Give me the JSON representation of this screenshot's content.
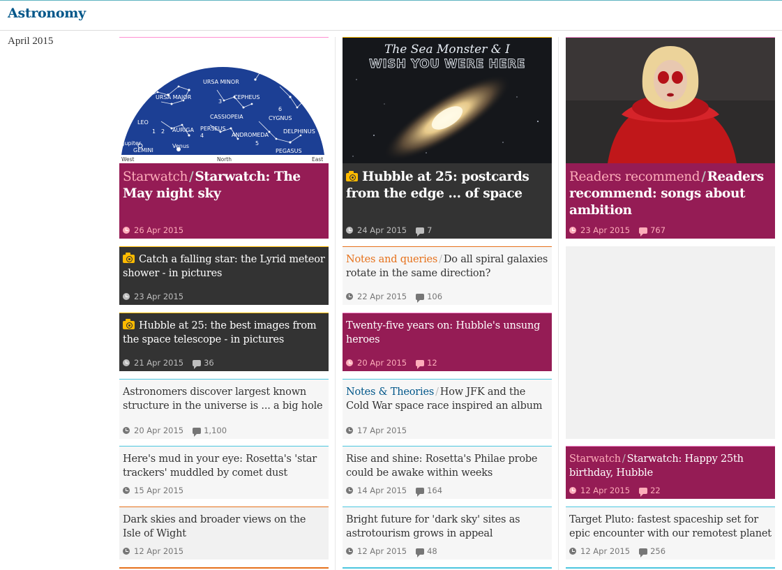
{
  "page": {
    "title": "Astronomy",
    "month": "April 2015"
  },
  "cards": {
    "c1": {
      "kicker": "Starwatch",
      "headline": "Starwatch: The May night sky",
      "date": "26 Apr 2015",
      "comments": ""
    },
    "c2": {
      "kicker": "",
      "headline": "Hubble at 25: postcards from the edge ... of space",
      "date": "24 Apr 2015",
      "comments": "7"
    },
    "c3": {
      "kicker": "Readers recommend",
      "headline": "Readers recommend: songs about ambition",
      "date": "23 Apr 2015",
      "comments": "767"
    },
    "c4": {
      "kicker": "",
      "headline": "Catch a falling star: the Lyrid meteor shower - in pictures",
      "date": "23 Apr 2015",
      "comments": ""
    },
    "c5": {
      "kicker": "Notes and queries",
      "headline": "Do all spiral galaxies rotate in the same direction?",
      "date": "22 Apr 2015",
      "comments": "106"
    },
    "c6": {
      "kicker": "",
      "headline": "Hubble at 25: the best images from the space telescope - in pictures",
      "date": "21 Apr 2015",
      "comments": "36"
    },
    "c7": {
      "kicker": "",
      "headline": "Twenty-five years on: Hubble's unsung heroes",
      "date": "20 Apr 2015",
      "comments": "12"
    },
    "c8": {
      "kicker": "",
      "headline": "Astronomers discover largest known structure in the universe is ... a big hole",
      "date": "20 Apr 2015",
      "comments": "1,100"
    },
    "c9": {
      "kicker": "Notes & Theories",
      "headline": "How JFK and the Cold War space race inspired an album",
      "date": "17 Apr 2015",
      "comments": ""
    },
    "c10": {
      "kicker": "",
      "headline": "Here's mud in your eye: Rosetta's 'star trackers' muddled by comet dust",
      "date": "15 Apr 2015",
      "comments": ""
    },
    "c11": {
      "kicker": "",
      "headline": "Rise and shine: Rosetta's Philae probe could be awake within weeks",
      "date": "14 Apr 2015",
      "comments": "164"
    },
    "c12": {
      "kicker": "Starwatch",
      "headline": "Starwatch: Happy 25th birthday, Hubble",
      "date": "12 Apr 2015",
      "comments": "22"
    },
    "c13": {
      "kicker": "",
      "headline": "Dark skies and broader views on the Isle of Wight",
      "date": "12 Apr 2015",
      "comments": ""
    },
    "c14": {
      "kicker": "",
      "headline": "Bright future for 'dark sky' sites as astrotourism grows in appeal",
      "date": "12 Apr 2015",
      "comments": "48"
    },
    "c15": {
      "kicker": "",
      "headline": "Target Pluto: fastest spaceship set for epic encounter with our remotest planet",
      "date": "12 Apr 2015",
      "comments": "256"
    }
  },
  "images": {
    "starmap": {
      "labels": [
        "URSA MAJOR",
        "URSA MINOR",
        "CEPHEUS",
        "CASSIOPEIA",
        "LEO",
        "AURIGA",
        "PERSEUS",
        "ANDROMEDA",
        "CYGNUS",
        "DELPHINUS",
        "PEGASUS",
        "Jupiter",
        "GEMINI",
        "Venus",
        "West",
        "North",
        "East"
      ],
      "numbers": [
        "1",
        "2",
        "3",
        "4",
        "5",
        "6"
      ]
    },
    "postcard": {
      "line1": "The Sea Monster & I",
      "line2": "WISH YOU WERE HERE"
    }
  },
  "colors": {
    "culture": "#951c55",
    "media": "#333333",
    "accent_blue": "#005689",
    "comment_orange": "#e6711b",
    "camera_yellow": "#ffbb00"
  },
  "icons": [
    "clock-icon",
    "comment-icon",
    "camera-icon"
  ]
}
